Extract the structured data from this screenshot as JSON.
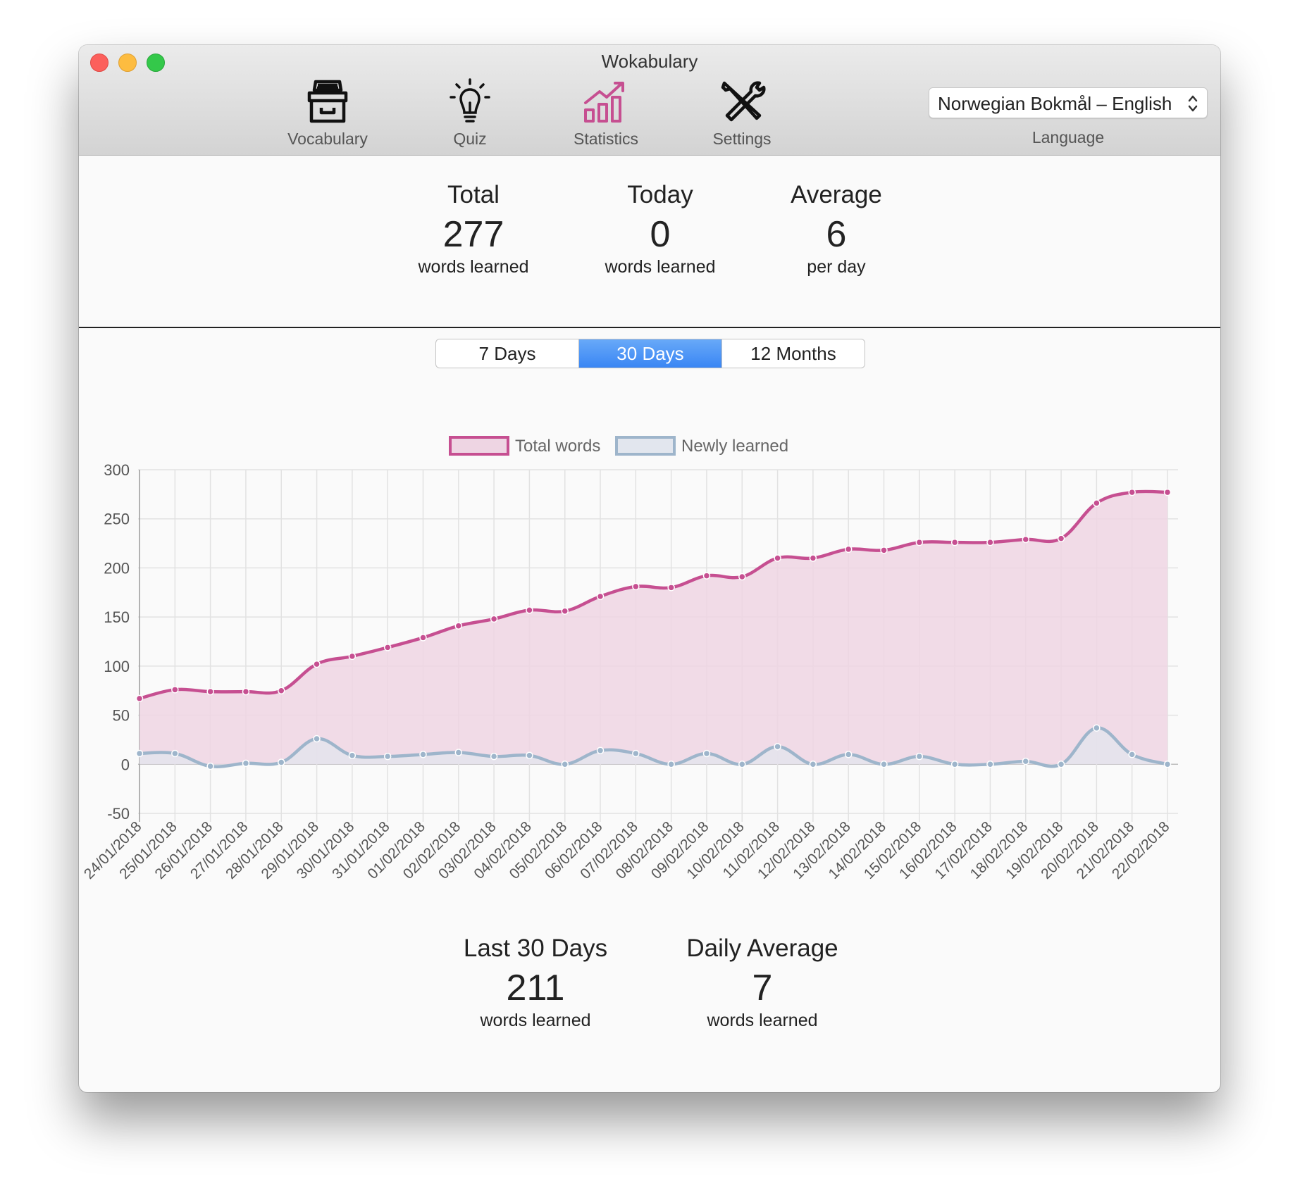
{
  "window": {
    "title": "Wokabulary"
  },
  "toolbar": {
    "items": [
      {
        "label": "Vocabulary",
        "icon": "vocabulary-box-icon"
      },
      {
        "label": "Quiz",
        "icon": "lightbulb-icon"
      },
      {
        "label": "Statistics",
        "icon": "statistics-chart-icon",
        "active": true
      },
      {
        "label": "Settings",
        "icon": "wrench-screwdriver-icon"
      }
    ],
    "language": {
      "value": "Norwegian Bokmål – English",
      "label": "Language"
    }
  },
  "summary": {
    "total": {
      "title": "Total",
      "value": "277",
      "sub": "words learned"
    },
    "today": {
      "title": "Today",
      "value": "0",
      "sub": "words learned"
    },
    "average": {
      "title": "Average",
      "value": "6",
      "sub": "per day"
    }
  },
  "range_tabs": {
    "options": [
      "7 Days",
      "30 Days",
      "12 Months"
    ],
    "selected": "30 Days"
  },
  "chart_data": {
    "type": "line",
    "x": [
      "24/01/2018",
      "25/01/2018",
      "26/01/2018",
      "27/01/2018",
      "28/01/2018",
      "29/01/2018",
      "30/01/2018",
      "31/01/2018",
      "01/02/2018",
      "02/02/2018",
      "03/02/2018",
      "04/02/2018",
      "05/02/2018",
      "06/02/2018",
      "07/02/2018",
      "08/02/2018",
      "09/02/2018",
      "10/02/2018",
      "11/02/2018",
      "12/02/2018",
      "13/02/2018",
      "14/02/2018",
      "15/02/2018",
      "16/02/2018",
      "17/02/2018",
      "18/02/2018",
      "19/02/2018",
      "20/02/2018",
      "21/02/2018",
      "22/02/2018"
    ],
    "series": [
      {
        "name": "Total words",
        "color": "#c64f91",
        "fill": "#eed5e3",
        "values": [
          67,
          76,
          74,
          74,
          75,
          102,
          110,
          119,
          129,
          141,
          148,
          157,
          156,
          171,
          181,
          180,
          192,
          191,
          210,
          210,
          219,
          218,
          226,
          226,
          226,
          229,
          230,
          266,
          277,
          277
        ]
      },
      {
        "name": "Newly learned",
        "color": "#9eb5cb",
        "fill": "#e2e6ee",
        "values": [
          11,
          11,
          -2,
          1,
          2,
          26,
          9,
          8,
          10,
          12,
          8,
          9,
          0,
          14,
          11,
          0,
          11,
          0,
          18,
          0,
          10,
          0,
          8,
          0,
          0,
          3,
          0,
          37,
          10,
          0
        ]
      }
    ],
    "yticks": [
      300,
      250,
      200,
      150,
      100,
      50,
      0,
      -50
    ],
    "ylim": [
      -50,
      300
    ],
    "grid": true,
    "legend": "top-center"
  },
  "period_summary": {
    "last30": {
      "title": "Last 30 Days",
      "value": "211",
      "sub": "words learned"
    },
    "daily_avg": {
      "title": "Daily Average",
      "value": "7",
      "sub": "words learned"
    }
  }
}
